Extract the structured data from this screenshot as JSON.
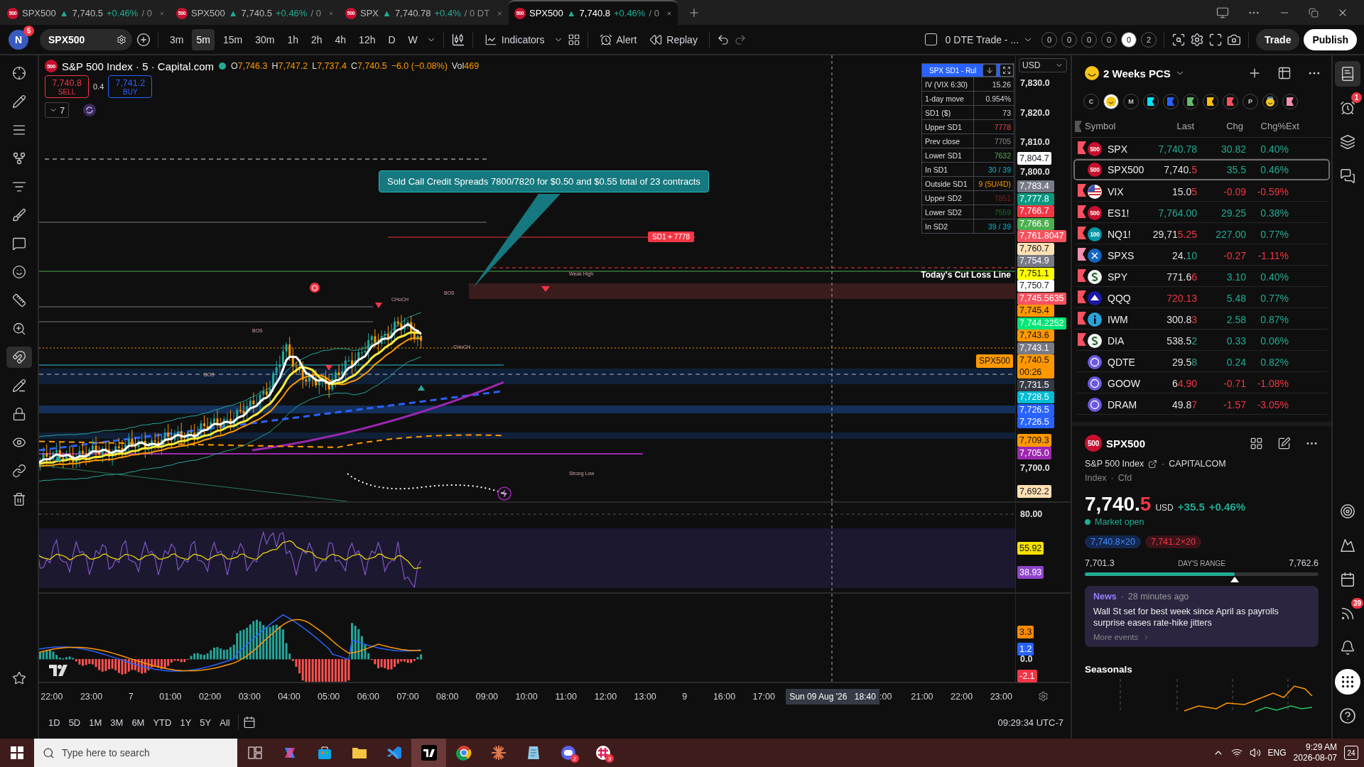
{
  "browser_tabs": [
    {
      "logo": "500",
      "symbol": "SPX500",
      "arrow": "▲",
      "price": "7,740.5",
      "change": "+0.46%",
      "extra": "/ 0",
      "selected": false
    },
    {
      "logo": "500",
      "symbol": "SPX500",
      "arrow": "▲",
      "price": "7,740.5",
      "change": "+0.46%",
      "extra": "/ 0",
      "selected": false
    },
    {
      "logo": "500",
      "symbol": "SPX",
      "arrow": "▲",
      "price": "7,740.78",
      "change": "+0.4%",
      "extra": "/ 0 DT",
      "selected": false
    },
    {
      "logo": "500",
      "symbol": "SPX500",
      "arrow": "▲",
      "price": "7,740.8",
      "change": "+0.46%",
      "extra": "/ 0",
      "selected": true
    }
  ],
  "toolbar": {
    "avatar": "N",
    "avatar_badge": "6",
    "symbol": "SPX500",
    "intervals": [
      {
        "label": "3m",
        "selected": false
      },
      {
        "label": "5m",
        "selected": true
      },
      {
        "label": "15m",
        "selected": false
      },
      {
        "label": "30m",
        "selected": false
      },
      {
        "label": "1h",
        "selected": false
      },
      {
        "label": "2h",
        "selected": false
      },
      {
        "label": "4h",
        "selected": false
      },
      {
        "label": "12h",
        "selected": false
      },
      {
        "label": "D",
        "selected": false
      },
      {
        "label": "W",
        "selected": false
      }
    ],
    "indicators": "Indicators",
    "alert": "Alert",
    "replay": "Replay",
    "trade_panel": "0 DTE Trade - ...",
    "trade_panel_checked": false,
    "counters": [
      {
        "label": "0",
        "selected": false
      },
      {
        "label": "0",
        "selected": false
      },
      {
        "label": "0",
        "selected": false
      },
      {
        "label": "0",
        "selected": false
      },
      {
        "label": "0",
        "selected": true
      },
      {
        "label": "2",
        "selected": false
      }
    ],
    "trade": "Trade",
    "publish": "Publish"
  },
  "chart": {
    "logo": "500",
    "title": "S&P 500 Index · 5 · Capital.com",
    "ohlc": [
      {
        "label": "O",
        "value": "7,746.3"
      },
      {
        "label": "H",
        "value": "7,747.2"
      },
      {
        "label": "L",
        "value": "7,737.4"
      },
      {
        "label": "C",
        "value": "7,740.5"
      }
    ],
    "change": "−6.0 (−0.08%)",
    "volume_label": "Vol",
    "volume": "469",
    "sell_price": "7,740.8",
    "sell_label": "SELL",
    "spread": "0.4",
    "buy_price": "7,741.2",
    "buy_label": "BUY",
    "collapse_count": "7",
    "sd_table": {
      "title": "SPX SD1 - Rul",
      "rows": [
        {
          "label": "IV (VIX 6:30)",
          "value": "15.26",
          "color": "#d1d4dc"
        },
        {
          "label": "1-day move",
          "value": "0.954%",
          "color": "#d1d4dc"
        },
        {
          "label": "SD1 ($)",
          "value": "73",
          "color": "#d1d4dc"
        },
        {
          "label": "Upper SD1",
          "value": "7778",
          "color": "#e0404a"
        },
        {
          "label": "Prev close",
          "value": "7705",
          "color": "#8a8a8a"
        },
        {
          "label": "Lower SD1",
          "value": "7632",
          "color": "#4caf50"
        },
        {
          "label": "In SD1",
          "value": "30 / 39",
          "color": "#00bcd4"
        },
        {
          "label": "Outside SD1",
          "value": "9  (5U/4D)",
          "color": "#ff9800"
        },
        {
          "label": "Upper SD2",
          "value": "7851",
          "color": "#8b1a1a"
        },
        {
          "label": "Lower SD2",
          "value": "7559",
          "color": "#1b6e2a"
        },
        {
          "label": "In SD2",
          "value": "39 / 39",
          "color": "#00bcd4"
        }
      ]
    },
    "currency": "USD",
    "annotation": "Sold Call Credit Spreads 7800/7820 for $0.50 and $0.55 total of 23 contracts",
    "sd_line_label": "SD1 + 7778",
    "cut_loss_label": "Today's Cut Loss Line",
    "chart_labels": [
      "Weak High",
      "CHoCH",
      "BOS",
      "CHoCH",
      "BOS",
      "BOS",
      "Strong Low"
    ],
    "price_ticks": [
      "7,830.0",
      "7,820.0",
      "7,810.0",
      "7,800.0",
      "7,700.0"
    ],
    "price_levels": [
      {
        "value": "7,804.7",
        "color": "#ffffff"
      },
      {
        "value": "7,709.3",
        "color": "#ff9800"
      },
      {
        "value": "7,705.0",
        "color": "#9c27b0"
      },
      {
        "value": "7,692.2",
        "color": "#ffe0b2"
      }
    ],
    "price_stack": [
      {
        "value": "7,783.4",
        "color": "#787b86"
      },
      {
        "value": "7,777.8",
        "color": "#089981"
      },
      {
        "value": "7,766.7",
        "color": "#f23645"
      },
      {
        "value": "7,766.6",
        "color": "#4caf50"
      },
      {
        "value": "7,761.8047",
        "color": "#f7525f"
      },
      {
        "value": "7,760.7",
        "color": "#ffe0b2"
      },
      {
        "value": "7,754.9",
        "color": "#787b86"
      },
      {
        "value": "7,751.1",
        "color": "#ffff00"
      },
      {
        "value": "7,750.7",
        "color": "#ffffff"
      },
      {
        "value": "7,745.5635",
        "color": "#f7525f"
      },
      {
        "value": "7,745.4",
        "color": "#ff9800"
      },
      {
        "value": "7,744.2252",
        "color": "#00e676"
      },
      {
        "value": "7,743.6",
        "color": "#ff9800"
      },
      {
        "value": "7,743.1",
        "color": "#787b86"
      },
      {
        "value": "7,740.5",
        "color": "#ff9800",
        "countdown": "00:26",
        "tag": "SPX500"
      },
      {
        "value": "7,731.5",
        "color": "#363a45"
      },
      {
        "value": "7,728.5",
        "color": "#00bcd4"
      },
      {
        "value": "7,726.5",
        "color": "#2962ff"
      },
      {
        "value": "7,726.5",
        "color": "#2962ff"
      }
    ],
    "rsi": {
      "ticks": [
        "80.00"
      ],
      "levels": [
        {
          "value": "55.92",
          "color": "#f5e000"
        },
        {
          "value": "38.93",
          "color": "#8e44c9"
        }
      ]
    },
    "macd": {
      "ticks": [
        "0.0"
      ],
      "levels": [
        {
          "value": "3.3",
          "color": "#ff8a00"
        },
        {
          "value": "1.2",
          "color": "#2962ff"
        },
        {
          "value": "-2.1",
          "color": "#f23645"
        }
      ]
    },
    "time_axis": {
      "ticks_before": [
        "22:00",
        "23:00",
        "7",
        "01:00",
        "02:00",
        "03:00",
        "04:00",
        "05:00",
        "06:00",
        "07:00",
        "08:00",
        "09:00",
        "10:00",
        "11:00",
        "12:00",
        "13:00",
        "9",
        "16:00",
        "17:00"
      ],
      "crosshair_date": "Sun 09 Aug '26",
      "crosshair_time": "18:40",
      "partial": ":00",
      "ticks_after": [
        "21:00",
        "22:00",
        "23:00"
      ]
    }
  },
  "range_bar": {
    "ranges": [
      "1D",
      "5D",
      "1M",
      "3M",
      "6M",
      "YTD",
      "1Y",
      "5Y",
      "All"
    ],
    "clock": "09:29:34 UTC-7"
  },
  "watchlist": {
    "title": "2 Weeks PCS",
    "filters": [
      {
        "kind": "letter",
        "text": "C"
      },
      {
        "kind": "emoji"
      },
      {
        "kind": "letter",
        "text": "M"
      },
      {
        "kind": "flag",
        "color": "#00e5ff"
      },
      {
        "kind": "flag",
        "color": "#2962ff"
      },
      {
        "kind": "flag",
        "color": "#66bb6a"
      },
      {
        "kind": "flag",
        "color": "#ffc107"
      },
      {
        "kind": "flag",
        "color": "#f7525f"
      },
      {
        "kind": "letter",
        "text": "P"
      },
      {
        "kind": "angel"
      },
      {
        "kind": "flag",
        "color": "#f48fb1"
      }
    ],
    "columns": [
      "Symbol",
      "Last",
      "Chg",
      "Chg%",
      "Ext"
    ],
    "rows": [
      {
        "color": "#f7525f",
        "logo": {
          "kind": "crimson",
          "text": "500"
        },
        "symbol": "SPX",
        "last_tick": "7,740.78",
        "tick_up": true,
        "chg": "30.82",
        "pct": "0.40%",
        "positive": true,
        "selected": false
      },
      {
        "logo": {
          "kind": "crimson",
          "text": "500"
        },
        "symbol": "SPX500",
        "last_main": "7,740.",
        "last_tick": "5",
        "tick_up": false,
        "chg": "35.5",
        "pct": "0.46%",
        "positive": true,
        "selected": true
      },
      {
        "color": "#f7525f",
        "logo": {
          "kind": "usflag"
        },
        "symbol": "VIX",
        "last_main": "15.0",
        "last_tick": "5",
        "tick_up": false,
        "chg": "-0.09",
        "pct": "-0.59%",
        "positive": false,
        "selected": false
      },
      {
        "color": "#f7525f",
        "logo": {
          "kind": "crimson",
          "text": "500"
        },
        "symbol": "ES1!",
        "last_tick": "7,764.00",
        "tick_up": true,
        "chg": "29.25",
        "pct": "0.38%",
        "positive": true,
        "selected": false
      },
      {
        "color": "#f7525f",
        "logo": {
          "kind": "teal",
          "text": "100"
        },
        "symbol": "NQ1!",
        "last_main": "29,71",
        "last_tick": "5.25",
        "tick_up": false,
        "chg": "227.00",
        "pct": "0.77%",
        "positive": true,
        "selected": false
      },
      {
        "color": "#f48fb1",
        "logo": {
          "kind": "cross"
        },
        "symbol": "SPXS",
        "last_main": "24.",
        "last_tick": "10",
        "tick_up": true,
        "chg": "-0.27",
        "pct": "-1.11%",
        "positive": false,
        "selected": false
      },
      {
        "color": "#f7525f",
        "logo": {
          "kind": "coin"
        },
        "symbol": "SPY",
        "last_main": "771.6",
        "last_tick": "6",
        "tick_up": false,
        "chg": "3.10",
        "pct": "0.40%",
        "positive": true,
        "selected": false
      },
      {
        "color": "#f7525f",
        "logo": {
          "kind": "sail"
        },
        "symbol": "QQQ",
        "last_tick": "720.13",
        "tick_up": false,
        "chg": "5.48",
        "pct": "0.77%",
        "positive": true,
        "selected": false
      },
      {
        "color": "#f7525f",
        "logo": {
          "kind": "info"
        },
        "symbol": "IWM",
        "last_main": "300.8",
        "last_tick": "3",
        "tick_up": false,
        "chg": "2.58",
        "pct": "0.87%",
        "positive": true,
        "selected": false
      },
      {
        "color": "#f7525f",
        "logo": {
          "kind": "coin"
        },
        "symbol": "DIA",
        "last_main": "538.5",
        "last_tick": "2",
        "tick_up": true,
        "chg": "0.33",
        "pct": "0.06%",
        "positive": true,
        "selected": false
      },
      {
        "logo": {
          "kind": "ring"
        },
        "symbol": "QDTE",
        "last_main": "29.5",
        "last_tick": "8",
        "tick_up": true,
        "chg": "0.24",
        "pct": "0.82%",
        "positive": true,
        "selected": false
      },
      {
        "logo": {
          "kind": "ring"
        },
        "symbol": "GOOW",
        "last_main": "6",
        "last_tick": "4.90",
        "tick_up": false,
        "chg": "-0.71",
        "pct": "-1.08%",
        "positive": false,
        "selected": false
      },
      {
        "logo": {
          "kind": "ring"
        },
        "symbol": "DRAM",
        "last_main": "49.8",
        "last_tick": "7",
        "tick_up": false,
        "chg": "-1.57",
        "pct": "-3.05%",
        "positive": false,
        "selected": false
      }
    ]
  },
  "details": {
    "logo": "500",
    "symbol": "SPX500",
    "name": "S&P 500 Index",
    "separator": "·",
    "exchange": "CAPITALCOM",
    "type": "Index",
    "type_separator": "·",
    "subtype": "Cfd",
    "price_main": "7,740.",
    "price_tick": "5",
    "currency": "USD",
    "change": "+35.5",
    "change_pct": "+0.46%",
    "status": "Market open",
    "bid": "7,740.8×20",
    "ask": "7,741.2×20",
    "range_low": "7,701.3",
    "range_label": "DAY'S RANGE",
    "range_high": "7,762.6",
    "level": 0.64,
    "news": {
      "label": "News",
      "separator": "·",
      "time": "28 minutes ago",
      "headline": "Wall St set for best week since April as payrolls surprise eases rate-hike jitters",
      "more": "More events"
    },
    "seasonals": "Seasonals"
  },
  "side_badges": {
    "alerts": "1",
    "feed": "39"
  },
  "taskbar": {
    "search": "Type here to search",
    "app_badges": [
      "2",
      "3"
    ],
    "language": "ENG",
    "time": "9:29 AM",
    "date": "2026-08-07",
    "notifications": "24"
  }
}
